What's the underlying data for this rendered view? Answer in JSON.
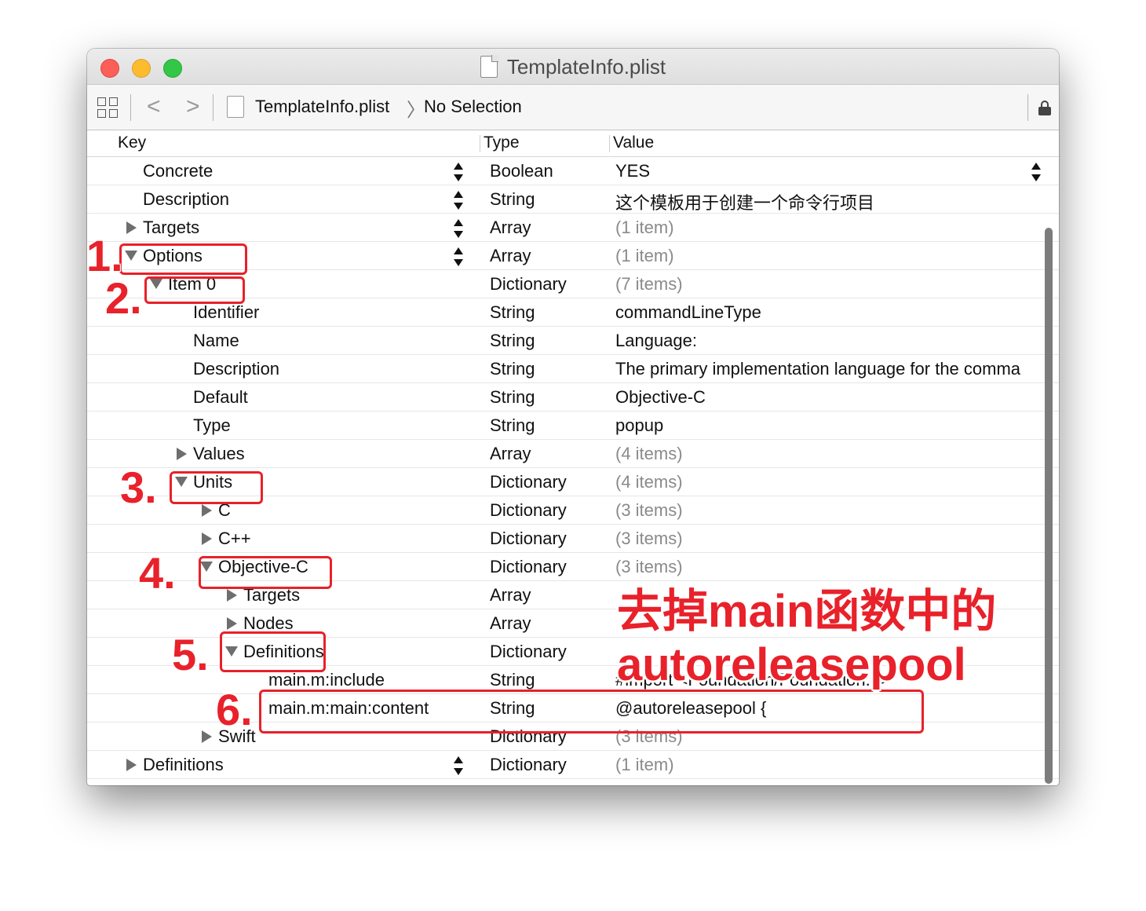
{
  "window": {
    "title": "TemplateInfo.plist"
  },
  "pathbar": {
    "file": "TemplateInfo.plist",
    "selection": "No Selection",
    "back_glyph": "<",
    "forward_glyph": ">",
    "separator_glyph": "〉"
  },
  "columns": {
    "key": "Key",
    "type": "Type",
    "value": "Value"
  },
  "rows": [
    {
      "key": "Concrete",
      "type": "Boolean",
      "value": "YES"
    },
    {
      "key": "Description",
      "type": "String",
      "value": "这个模板用于创建一个命令行项目"
    },
    {
      "key": "Targets",
      "type": "Array",
      "value": "(1 item)"
    },
    {
      "key": "Options",
      "type": "Array",
      "value": "(1 item)"
    },
    {
      "key": "Item 0",
      "type": "Dictionary",
      "value": "(7 items)"
    },
    {
      "key": "Identifier",
      "type": "String",
      "value": "commandLineType"
    },
    {
      "key": "Name",
      "type": "String",
      "value": "Language:"
    },
    {
      "key": "Description",
      "type": "String",
      "value": "The primary implementation language for the comma"
    },
    {
      "key": "Default",
      "type": "String",
      "value": "Objective-C"
    },
    {
      "key": "Type",
      "type": "String",
      "value": "popup"
    },
    {
      "key": "Values",
      "type": "Array",
      "value": "(4 items)"
    },
    {
      "key": "Units",
      "type": "Dictionary",
      "value": "(4 items)"
    },
    {
      "key": "C",
      "type": "Dictionary",
      "value": "(3 items)"
    },
    {
      "key": "C++",
      "type": "Dictionary",
      "value": "(3 items)"
    },
    {
      "key": "Objective-C",
      "type": "Dictionary",
      "value": "(3 items)"
    },
    {
      "key": "Targets",
      "type": "Array",
      "value": ""
    },
    {
      "key": "Nodes",
      "type": "Array",
      "value": ""
    },
    {
      "key": "Definitions",
      "type": "Dictionary",
      "value": ""
    },
    {
      "key": "main.m:include",
      "type": "String",
      "value": "#import <Foundation/Foundation.h>"
    },
    {
      "key": "main.m:main:content",
      "type": "String",
      "value": "@autoreleasepool {"
    },
    {
      "key": "Swift",
      "type": "Dictionary",
      "value": "(3 items)"
    },
    {
      "key": "Definitions",
      "type": "Dictionary",
      "value": "(1 item)"
    }
  ],
  "annotations": {
    "steps": [
      "1.",
      "2.",
      "3.",
      "4.",
      "5.",
      "6."
    ],
    "note_line1": "去掉main函数中的",
    "note_line2": "autoreleasepool"
  },
  "colors": {
    "annotation": "#e8212a",
    "scrollbar": "#7c7c7c",
    "dim_value": "#8a8a8a"
  }
}
